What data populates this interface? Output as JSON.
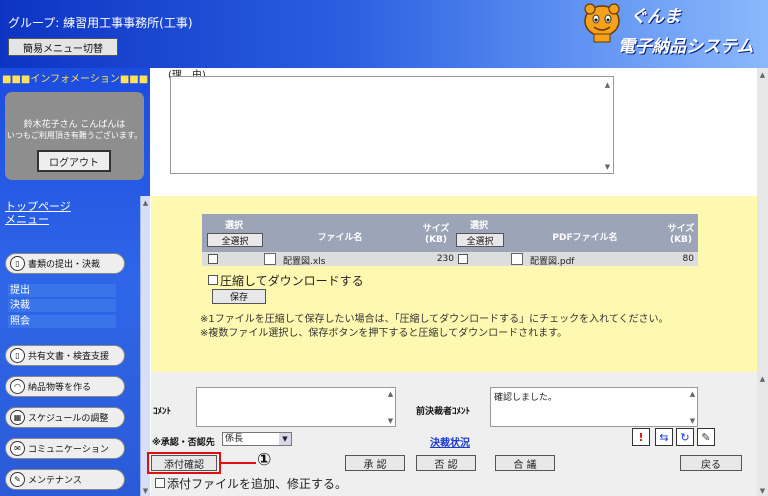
{
  "header": {
    "group": "グループ: 練習用工事事務所(工事)",
    "menu_switch": "簡易メニュー切替",
    "logo_top": "ぐんま",
    "logo_bottom": "電子納品システム"
  },
  "sidebar": {
    "info_label": "■■■インフォメーション■■■",
    "greeting_line1": "鈴木花子さん こんばんは",
    "greeting_line2": "いつもご利用頂き有難うございます。",
    "logout": "ログアウト",
    "top_page_line1": "トップページ",
    "top_page_line2": "メニュー",
    "items": [
      {
        "label": "書類の提出・決裁",
        "icon": "document-icon"
      },
      {
        "label": "共有文書・検査支援",
        "icon": "shared-document-icon"
      },
      {
        "label": "納品物等を作る",
        "icon": "create-icon"
      },
      {
        "label": "スケジュールの調整",
        "icon": "calendar-icon"
      },
      {
        "label": "コミュニケーション",
        "icon": "mail-icon"
      },
      {
        "label": "メンテナンス",
        "icon": "wrench-icon"
      }
    ],
    "subitems": [
      "提出",
      "決裁",
      "照会"
    ]
  },
  "reason": {
    "label": "(理　由)"
  },
  "attachments": {
    "col_select": "選択",
    "select_all": "全選択",
    "col_filename": "ファイル名",
    "col_size": "サイズ",
    "col_size_unit": "(KB)",
    "col_pdf_filename": "PDFファイル名",
    "row": {
      "filename": "配置図.xls",
      "size": "230",
      "pdf_filename": "配置図.pdf",
      "pdf_size": "80"
    },
    "compress_label": "圧縮してダウンロードする",
    "save_button": "保存",
    "note1": "※1ファイルを圧縮して保存したい場合は、「圧縮してダウンロードする」にチェックを入れてください。",
    "note2": "※複数ファイル選択し、保存ボタンを押下すると圧縮してダウンロードされます。"
  },
  "bottom": {
    "comment_label": "ｺﾒﾝﾄ",
    "prev_comment_label": "前決裁者ｺﾒﾝﾄ",
    "prev_comment_value": "確認しました。",
    "approver_label": "※承認・否認先",
    "approver_value": "係長",
    "status_link": "決裁状況",
    "attach_confirm": "添付確認",
    "annotation": "①",
    "approve": "承 認",
    "reject": "否 認",
    "consult": "合 議",
    "back": "戻る",
    "add_attach_label": "添付ファイルを追加、修正する。",
    "highlight_color": "#e01010"
  }
}
